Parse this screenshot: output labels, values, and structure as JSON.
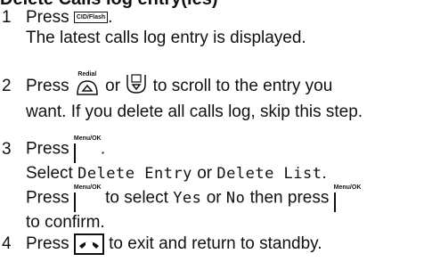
{
  "heading": "Delete Calls log entry(ies)",
  "keys": {
    "cid_flash": "CID/Flash",
    "redial": "Redial",
    "menu_ok": "Menu/OK"
  },
  "step1": {
    "num": "1",
    "press": "Press",
    "after_key": ".",
    "line2": "The latest calls log entry is displayed."
  },
  "step2": {
    "num": "2",
    "press": "Press",
    "or": "or",
    "after_keys": "to scroll to the entry you",
    "line2": "want. If you delete all calls log, skip this step."
  },
  "step3": {
    "num": "3",
    "press": "Press",
    "after_key": ".",
    "select": "Select",
    "opt1": "Delete Entry",
    "or": "or",
    "opt2": "Delete List",
    "period": ".",
    "press2": "Press",
    "to_select": "to select",
    "yes": "Yes",
    "or2": "or",
    "no": "No",
    "then_press": "then press",
    "confirm": "to confirm."
  },
  "step4": {
    "num": "4",
    "press": "Press",
    "rest": "to exit and return to standby."
  }
}
